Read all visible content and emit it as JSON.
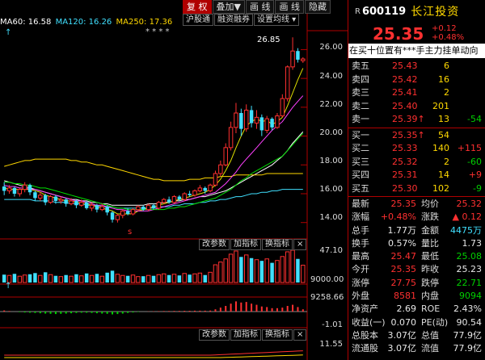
{
  "toolbar": {
    "buttons": [
      "复 权",
      "叠加▼",
      "画 线",
      "画 线",
      "隐藏"
    ],
    "sub": [
      "沪股通",
      "融资融券",
      "设置均线 ▾"
    ]
  },
  "ma_legend": [
    {
      "label": "MA60: 16.58",
      "color": "#ffffff"
    },
    {
      "label": "MA120: 16.26",
      "color": "#40e0ff"
    },
    {
      "label": "MA250: 17.36",
      "color": "#ffd800"
    }
  ],
  "price_axis": [
    "26.00",
    "24.00",
    "22.00",
    "20.00",
    "18.00",
    "16.00",
    "14.00"
  ],
  "high_marker": "26.85",
  "panel_buttons": [
    "改参数",
    "加指标",
    "换指标",
    "×"
  ],
  "vol_axis": [
    "47.10",
    "9000.00"
  ],
  "macd_axis": [
    "9258.66",
    "-1.01"
  ],
  "kdj_axis": [
    "11.55"
  ],
  "stock": {
    "code": "600119",
    "name": "长江投资",
    "price": "25.35",
    "change": "+0.12",
    "change_pct": "+0.48%",
    "ticker": "在买十位置有***手主力挂单动向"
  },
  "asks": [
    {
      "label": "卖五",
      "price": "25.43",
      "vol": "6",
      "chg": ""
    },
    {
      "label": "卖四",
      "price": "25.42",
      "vol": "16",
      "chg": ""
    },
    {
      "label": "卖三",
      "price": "25.41",
      "vol": "2",
      "chg": ""
    },
    {
      "label": "卖二",
      "price": "25.40",
      "vol": "201",
      "chg": ""
    },
    {
      "label": "卖一",
      "price": "25.39↑",
      "vol": "13",
      "chg": "-54"
    }
  ],
  "bids": [
    {
      "label": "买一",
      "price": "25.35↑",
      "vol": "54",
      "chg": ""
    },
    {
      "label": "买二",
      "price": "25.33",
      "vol": "140",
      "chg": "+115"
    },
    {
      "label": "买三",
      "price": "25.32",
      "vol": "2",
      "chg": "-60"
    },
    {
      "label": "买四",
      "price": "25.31",
      "vol": "14",
      "chg": "+9"
    },
    {
      "label": "买五",
      "price": "25.30",
      "vol": "102",
      "chg": "-9"
    }
  ],
  "stats": [
    {
      "l1": "最新",
      "v1": "25.35",
      "c1": "red",
      "l2": "均价",
      "v2": "25.32",
      "c2": "red"
    },
    {
      "l1": "涨幅",
      "v1": "+0.48%",
      "c1": "red",
      "l2": "涨跌",
      "v2": "▲ 0.12",
      "c2": "red"
    },
    {
      "l1": "总手",
      "v1": "1.77万",
      "c1": "white",
      "l2": "金额",
      "v2": "4475万",
      "c2": "cyan"
    },
    {
      "l1": "换手",
      "v1": "0.57%",
      "c1": "white",
      "l2": "量比",
      "v2": "1.73",
      "c2": "white"
    },
    {
      "l1": "最高",
      "v1": "25.47",
      "c1": "red",
      "l2": "最低",
      "v2": "25.08",
      "c2": "green"
    },
    {
      "l1": "今开",
      "v1": "25.35",
      "c1": "red",
      "l2": "昨收",
      "v2": "25.23",
      "c2": "white"
    },
    {
      "l1": "涨停",
      "v1": "27.75",
      "c1": "red",
      "l2": "跌停",
      "v2": "22.71",
      "c2": "green"
    },
    {
      "l1": "外盘",
      "v1": "8581",
      "c1": "red",
      "l2": "内盘",
      "v2": "9094",
      "c2": "green"
    },
    {
      "l1": "净资产",
      "v1": "2.69",
      "c1": "white",
      "l2": "ROE",
      "v2": "2.43%",
      "c2": "white"
    },
    {
      "l1": "收益(一)",
      "v1": "0.070",
      "c1": "white",
      "l2": "PE(动)",
      "v2": "90.54",
      "c2": "white"
    },
    {
      "l1": "总股本",
      "v1": "3.07亿",
      "c1": "white",
      "l2": "总值",
      "v2": "77.9亿",
      "c2": "white"
    },
    {
      "l1": "流通股",
      "v1": "3.07亿",
      "c1": "white",
      "l2": "流值",
      "v2": "77.9亿",
      "c2": "white"
    }
  ],
  "chart_data": {
    "type": "candlestick",
    "ylim": [
      13.2,
      27.2
    ],
    "candles": [
      [
        16.5,
        16.2,
        16.8,
        15.9
      ],
      [
        16.2,
        16.4,
        16.6,
        16.0
      ],
      [
        16.4,
        16.0,
        16.5,
        15.8
      ],
      [
        16.0,
        16.3,
        16.4,
        15.8
      ],
      [
        16.3,
        16.6,
        16.8,
        16.1
      ],
      [
        16.6,
        16.1,
        16.7,
        15.9
      ],
      [
        16.1,
        15.7,
        16.2,
        15.5
      ],
      [
        15.7,
        15.9,
        16.1,
        15.5
      ],
      [
        15.9,
        15.4,
        16.0,
        15.2
      ],
      [
        15.4,
        15.8,
        15.9,
        15.3
      ],
      [
        15.8,
        15.5,
        15.9,
        15.3
      ],
      [
        15.5,
        15.6,
        15.8,
        15.3
      ],
      [
        15.6,
        15.3,
        15.7,
        15.1
      ],
      [
        15.3,
        15.5,
        15.7,
        15.2
      ],
      [
        15.5,
        15.2,
        15.6,
        15.0
      ],
      [
        15.2,
        15.4,
        15.6,
        15.1
      ],
      [
        15.4,
        15.0,
        15.5,
        14.9
      ],
      [
        15.0,
        15.2,
        15.4,
        14.8
      ],
      [
        15.2,
        14.9,
        15.3,
        14.7
      ],
      [
        14.9,
        15.1,
        15.3,
        14.8
      ],
      [
        15.1,
        14.7,
        15.2,
        14.5
      ],
      [
        14.7,
        14.2,
        14.8,
        14.0
      ],
      [
        14.2,
        14.5,
        14.6,
        14.0
      ],
      [
        14.5,
        14.8,
        14.9,
        14.3
      ],
      [
        14.8,
        14.6,
        15.0,
        14.5
      ],
      [
        14.6,
        14.9,
        15.0,
        14.5
      ],
      [
        14.9,
        15.1,
        15.2,
        14.8
      ],
      [
        15.1,
        14.9,
        15.2,
        14.8
      ],
      [
        14.9,
        15.2,
        15.3,
        14.8
      ],
      [
        15.2,
        15.0,
        15.3,
        14.9
      ],
      [
        15.0,
        15.4,
        15.5,
        14.9
      ],
      [
        15.4,
        15.6,
        15.7,
        15.3
      ],
      [
        15.6,
        15.4,
        15.8,
        15.3
      ],
      [
        15.4,
        15.8,
        15.9,
        15.3
      ],
      [
        15.8,
        15.6,
        15.9,
        15.5
      ],
      [
        15.6,
        16.0,
        16.1,
        15.5
      ],
      [
        16.0,
        15.9,
        16.2,
        15.8
      ],
      [
        15.9,
        16.2,
        16.3,
        15.8
      ],
      [
        16.2,
        16.4,
        16.6,
        16.1
      ],
      [
        16.4,
        16.2,
        16.5,
        16.0
      ],
      [
        16.2,
        16.6,
        16.7,
        16.1
      ],
      [
        16.6,
        17.4,
        17.6,
        16.5
      ],
      [
        17.4,
        18.0,
        18.3,
        17.2
      ],
      [
        18.0,
        19.2,
        19.5,
        17.9
      ],
      [
        19.2,
        20.6,
        21.0,
        19.0
      ],
      [
        20.6,
        21.6,
        22.3,
        20.2
      ],
      [
        21.6,
        20.5,
        21.9,
        20.0
      ],
      [
        20.5,
        21.8,
        22.2,
        20.3
      ],
      [
        21.8,
        20.9,
        22.1,
        20.6
      ],
      [
        20.9,
        21.3,
        21.8,
        20.5
      ],
      [
        21.3,
        20.4,
        21.5,
        20.0
      ],
      [
        20.4,
        21.2,
        21.4,
        20.2
      ],
      [
        21.2,
        20.6,
        21.3,
        20.4
      ],
      [
        20.6,
        21.4,
        21.6,
        20.5
      ],
      [
        21.4,
        22.6,
        22.9,
        21.3
      ],
      [
        22.6,
        24.8,
        24.9,
        22.4
      ],
      [
        24.8,
        25.9,
        26.85,
        24.6
      ],
      [
        25.9,
        25.3,
        26.1,
        25.1
      ],
      [
        25.23,
        25.35,
        25.47,
        25.08
      ]
    ],
    "ma_series": [
      {
        "name": "MA60",
        "color": "#ffffff",
        "values": [
          16.9,
          16.8,
          16.7,
          16.6,
          16.5,
          16.4,
          16.3,
          16.2,
          16.1,
          16.0,
          15.9,
          15.8,
          15.7,
          15.6,
          15.6,
          15.5,
          15.5,
          15.4,
          15.4,
          15.3,
          15.3,
          15.2,
          15.2,
          15.2,
          15.2,
          15.2,
          15.2,
          15.2,
          15.3,
          15.3,
          15.3,
          15.4,
          15.4,
          15.5,
          15.5,
          15.6,
          15.6,
          15.7,
          15.8,
          15.8,
          15.9,
          16.0,
          16.1,
          16.2,
          16.4,
          16.6,
          16.8,
          17.0,
          17.2,
          17.4,
          17.6,
          17.8,
          18.0,
          18.3,
          18.6,
          19.0,
          19.5,
          19.9,
          20.3
        ]
      },
      {
        "name": "MA120",
        "color": "#40e0ff",
        "values": [
          15.6,
          15.6,
          15.6,
          15.6,
          15.6,
          15.6,
          15.5,
          15.5,
          15.5,
          15.5,
          15.4,
          15.4,
          15.4,
          15.3,
          15.3,
          15.3,
          15.2,
          15.2,
          15.2,
          15.1,
          15.1,
          15.1,
          15.0,
          15.0,
          15.0,
          15.0,
          15.0,
          15.0,
          15.0,
          15.0,
          15.1,
          15.1,
          15.1,
          15.2,
          15.2,
          15.3,
          15.3,
          15.3,
          15.4,
          15.4,
          15.5,
          15.5,
          15.6,
          15.6,
          15.7,
          15.8,
          15.8,
          15.9,
          16.0,
          16.0,
          16.1,
          16.1,
          16.2,
          16.2,
          16.3,
          16.3,
          16.3,
          16.3,
          16.3
        ]
      },
      {
        "name": "MA250",
        "color": "#ffd800",
        "values": [
          17.9,
          18.0,
          18.1,
          18.2,
          18.3,
          18.3,
          18.4,
          18.4,
          18.4,
          18.4,
          18.4,
          18.4,
          18.4,
          18.3,
          18.3,
          18.2,
          18.2,
          18.1,
          18.0,
          18.0,
          17.9,
          17.8,
          17.7,
          17.6,
          17.5,
          17.4,
          17.3,
          17.2,
          17.1,
          17.0,
          17.0,
          16.9,
          16.9,
          16.9,
          16.9,
          16.9,
          17.0,
          17.0,
          17.0,
          17.1,
          17.1,
          17.1,
          17.2,
          17.2,
          17.2,
          17.3,
          17.3,
          17.3,
          17.3,
          17.3,
          17.3,
          17.4,
          17.4,
          17.4,
          17.4,
          17.4,
          17.4,
          17.4,
          17.4
        ]
      },
      {
        "name": "MA5",
        "color": "#e0e000",
        "values": [
          16.4,
          16.3,
          16.3,
          16.3,
          16.3,
          16.3,
          16.2,
          16.1,
          15.9,
          15.8,
          15.7,
          15.6,
          15.5,
          15.5,
          15.4,
          15.4,
          15.3,
          15.2,
          15.1,
          15.0,
          14.9,
          14.8,
          14.6,
          14.6,
          14.6,
          14.6,
          14.8,
          14.9,
          15.0,
          15.1,
          15.2,
          15.3,
          15.4,
          15.5,
          15.6,
          15.7,
          15.8,
          15.9,
          16.0,
          16.1,
          16.3,
          16.6,
          17.0,
          17.6,
          18.3,
          19.2,
          20.0,
          20.7,
          21.0,
          21.2,
          21.0,
          21.1,
          20.8,
          21.0,
          21.3,
          22.1,
          23.0,
          23.9,
          24.7
        ]
      },
      {
        "name": "MA10",
        "color": "#ff40ff",
        "values": [
          16.6,
          16.5,
          16.5,
          16.4,
          16.4,
          16.3,
          16.3,
          16.2,
          16.1,
          16.0,
          15.9,
          15.8,
          15.7,
          15.6,
          15.5,
          15.5,
          15.4,
          15.3,
          15.2,
          15.2,
          15.1,
          15.0,
          14.9,
          14.9,
          14.8,
          14.8,
          14.8,
          14.8,
          14.8,
          14.9,
          15.0,
          15.1,
          15.2,
          15.3,
          15.4,
          15.5,
          15.6,
          15.7,
          15.8,
          15.9,
          16.0,
          16.1,
          16.4,
          16.7,
          17.1,
          17.5,
          18.0,
          18.4,
          18.8,
          19.2,
          19.6,
          20.0,
          20.4,
          20.7,
          21.0,
          21.5,
          22.0,
          22.4,
          22.8
        ]
      },
      {
        "name": "MA20",
        "color": "#00e000",
        "values": [
          16.8,
          16.8,
          16.7,
          16.7,
          16.6,
          16.6,
          16.5,
          16.4,
          16.4,
          16.3,
          16.2,
          16.1,
          16.0,
          15.9,
          15.8,
          15.7,
          15.6,
          15.5,
          15.4,
          15.3,
          15.2,
          15.1,
          15.0,
          15.0,
          14.9,
          14.9,
          14.9,
          14.9,
          14.9,
          14.9,
          14.9,
          14.9,
          15.0,
          15.0,
          15.1,
          15.1,
          15.2,
          15.3,
          15.4,
          15.5,
          15.6,
          15.7,
          15.9,
          16.1,
          16.3,
          16.6,
          16.9,
          17.1,
          17.4,
          17.6,
          17.8,
          18.0,
          18.2,
          18.4,
          18.6,
          19.0,
          19.4,
          19.8,
          20.2
        ]
      }
    ],
    "volume": [
      20,
      18,
      22,
      16,
      19,
      21,
      24,
      18,
      26,
      20,
      17,
      15,
      19,
      16,
      21,
      17,
      23,
      18,
      22,
      16,
      25,
      30,
      21,
      18,
      17,
      19,
      15,
      16,
      18,
      17,
      20,
      22,
      19,
      21,
      18,
      23,
      20,
      22,
      24,
      19,
      26,
      45,
      52,
      60,
      72,
      80,
      65,
      70,
      62,
      58,
      55,
      60,
      50,
      56,
      66,
      78,
      82,
      60,
      44
    ],
    "macd": [
      0.1,
      0.05,
      0,
      -0.05,
      -0.08,
      -0.1,
      -0.12,
      -0.15,
      -0.18,
      -0.2,
      -0.22,
      -0.2,
      -0.18,
      -0.15,
      -0.12,
      -0.1,
      -0.1,
      -0.12,
      -0.15,
      -0.18,
      -0.2,
      -0.25,
      -0.22,
      -0.18,
      -0.12,
      -0.08,
      -0.04,
      0,
      0.02,
      0.03,
      0.04,
      0.05,
      0.05,
      0.06,
      0.06,
      0.07,
      0.07,
      0.08,
      0.08,
      0.08,
      0.09,
      0.2,
      0.35,
      0.5,
      0.7,
      0.9,
      0.8,
      0.85,
      0.7,
      0.6,
      0.45,
      0.4,
      0.3,
      0.3,
      0.35,
      0.5,
      0.6,
      0.4,
      0.2
    ]
  }
}
